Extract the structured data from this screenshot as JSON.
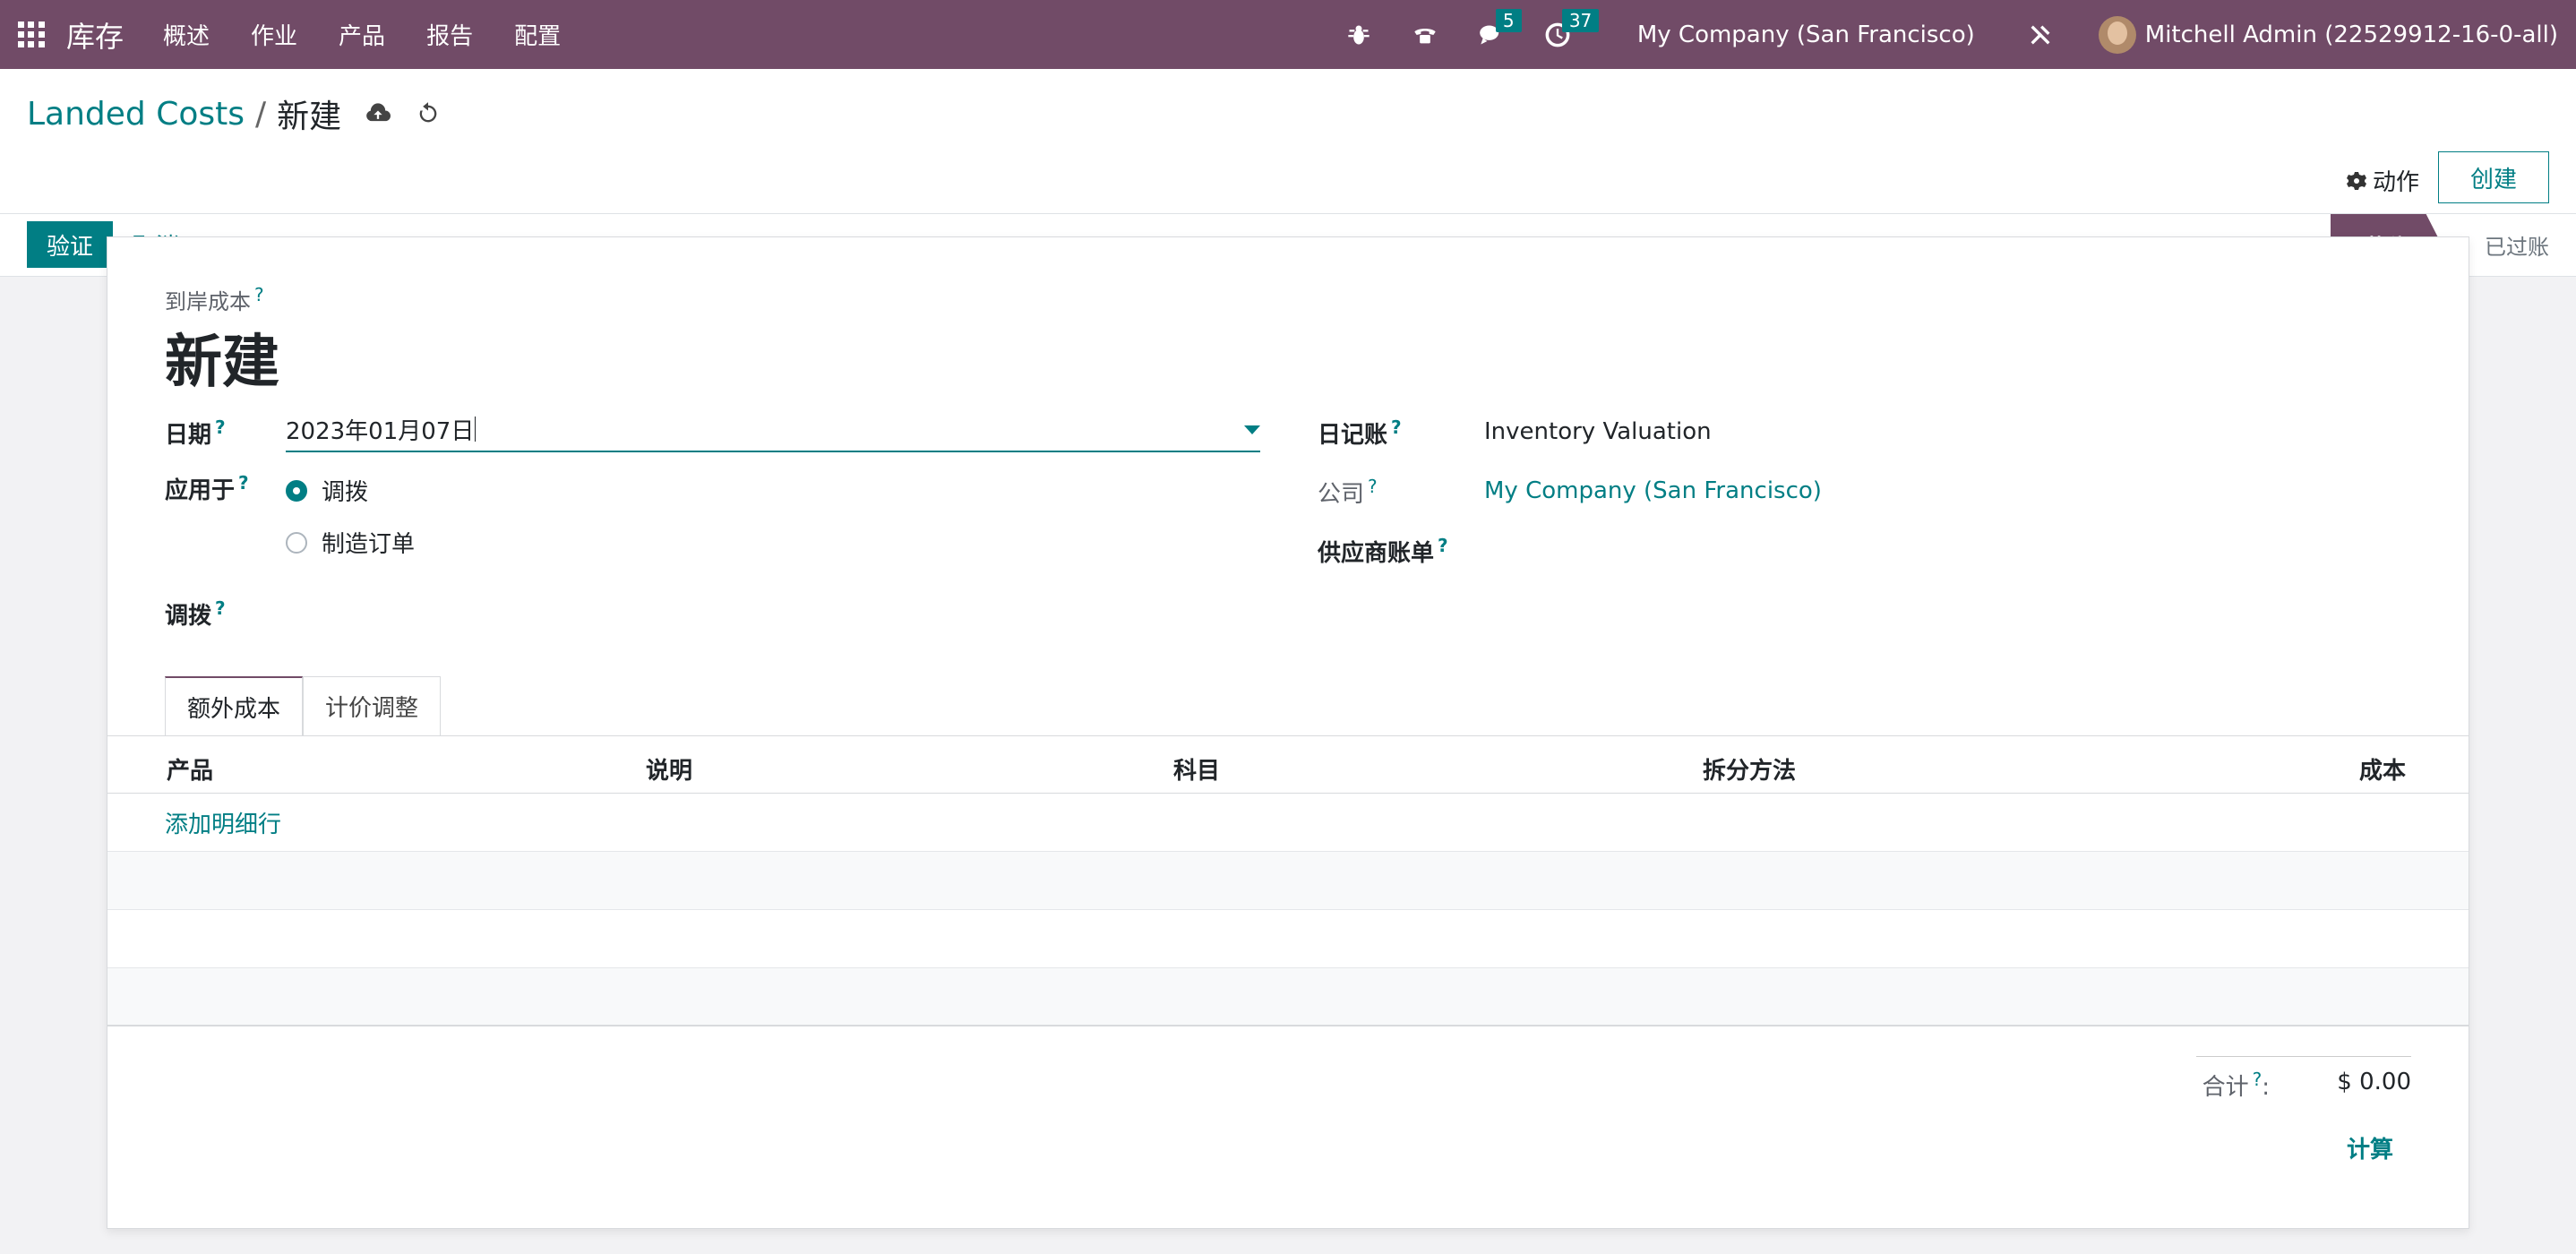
{
  "navbar": {
    "brand": "库存",
    "menu": [
      "概述",
      "作业",
      "产品",
      "报告",
      "配置"
    ],
    "messages_count": "5",
    "activities_count": "37",
    "company": "My Company (San Francisco)",
    "user": "Mitchell Admin (22529912-16-0-all)",
    "color": "#714b67"
  },
  "breadcrumb": {
    "parent": "Landed Costs",
    "separator": "/",
    "current": "新建"
  },
  "control": {
    "actions_label": "动作",
    "create_label": "创建"
  },
  "statusbar": {
    "validate_label": "验证",
    "cancel_label": "取消",
    "stages": [
      "草稿",
      "已过账"
    ]
  },
  "form": {
    "title_label": "到岸成本",
    "help_mark": "?",
    "title": "新建",
    "date_label": "日期",
    "date_value": "2023年01月07日",
    "apply_on_label": "应用于",
    "apply_options": [
      "调拨",
      "制造订单"
    ],
    "transfers_label": "调拨",
    "journal_label": "日记账",
    "journal_value": "Inventory Valuation",
    "company_label": "公司",
    "company_value": "My Company (San Francisco)",
    "vendor_bill_label": "供应商账单"
  },
  "tabs": [
    "额外成本",
    "计价调整"
  ],
  "table": {
    "columns": [
      "产品",
      "说明",
      "科目",
      "拆分方法",
      "成本"
    ],
    "add_line": "添加明细行"
  },
  "totals": {
    "label": "合计",
    "colon": ":",
    "value": "$ 0.00",
    "compute_label": "计算"
  },
  "accent": "#017e84"
}
